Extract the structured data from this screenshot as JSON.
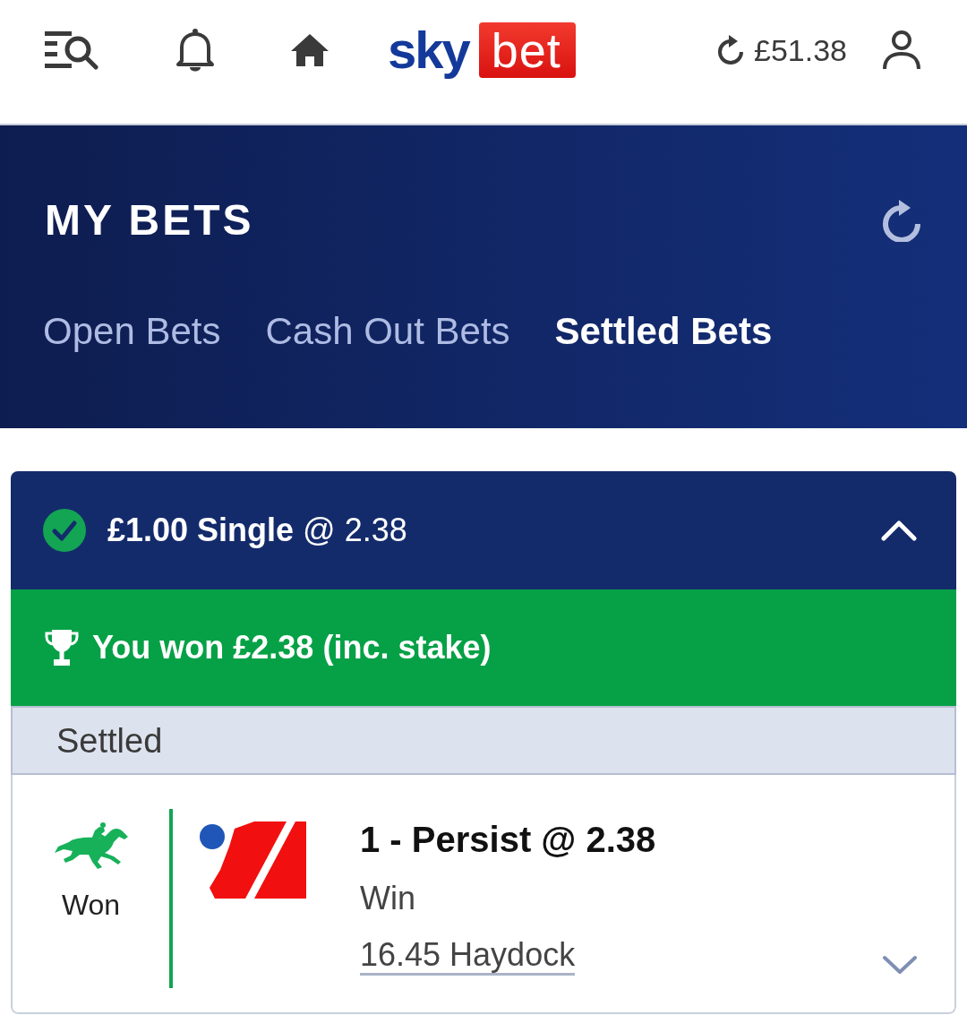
{
  "header": {
    "logo": {
      "word_1": "sky",
      "word_2": "bet"
    },
    "balance": "£51.38"
  },
  "page": {
    "title": "MY BETS",
    "tabs": [
      {
        "label": "Open Bets",
        "selected": false
      },
      {
        "label": "Cash Out Bets",
        "selected": false
      },
      {
        "label": "Settled Bets",
        "selected": true
      }
    ]
  },
  "bets": [
    {
      "won": true,
      "summary": "**£1.00 Single** @ 2.38",
      "expanded": true,
      "result_message": "You won £2.38 (inc. stake)",
      "section_label": "Settled",
      "selections": [
        {
          "result": "Won",
          "won": true,
          "title": "1 - Persist @ 2.38",
          "market": "Win",
          "event": "16.45 Haydock",
          "expanded": false
        }
      ]
    }
  ]
}
